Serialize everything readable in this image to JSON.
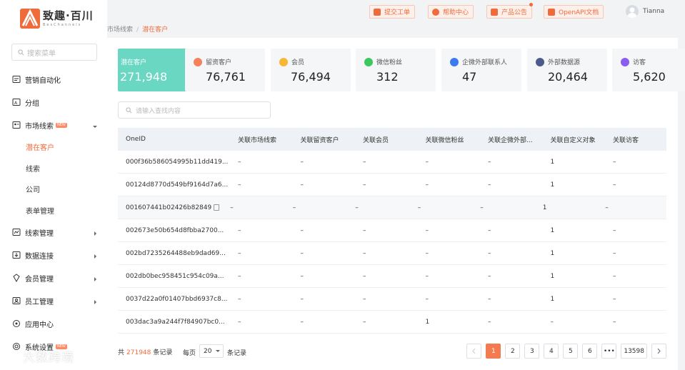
{
  "brand": {
    "name": "致趣·百川",
    "subtitle": "BesChannels"
  },
  "sidebar": {
    "search_placeholder": "搜索菜单",
    "items": [
      {
        "label": "营销自动化",
        "icon": "automation-icon"
      },
      {
        "label": "分组",
        "icon": "group-icon"
      },
      {
        "label": "市场线索",
        "icon": "leads-icon",
        "badge": "NEW",
        "expanded": true
      },
      {
        "label": "线索管理",
        "icon": "lead-manage-icon"
      },
      {
        "label": "数据连接",
        "icon": "data-connect-icon"
      },
      {
        "label": "会员管理",
        "icon": "member-icon"
      },
      {
        "label": "员工管理",
        "icon": "staff-icon"
      },
      {
        "label": "应用中心",
        "icon": "app-center-icon"
      },
      {
        "label": "系统设置",
        "icon": "settings-icon",
        "badge": "NEW"
      }
    ],
    "submenu": [
      "潜在客户",
      "线索",
      "公司",
      "表单管理"
    ]
  },
  "topbar": {
    "buttons": [
      "提交工单",
      "帮助中心",
      "产品公告",
      "OpenAPI文档"
    ],
    "user": "Tianna"
  },
  "breadcrumb": {
    "parent": "市场线索",
    "current": "潜在客户"
  },
  "stats": [
    {
      "label": "潜在客户",
      "value": "271,948",
      "color": "#6ad7c3"
    },
    {
      "label": "留资客户",
      "value": "76,761",
      "color": "#f5825a"
    },
    {
      "label": "会员",
      "value": "76,494",
      "color": "#f7b733"
    },
    {
      "label": "微信粉丝",
      "value": "312",
      "color": "#3cc860"
    },
    {
      "label": "企微外部联系人",
      "value": "47",
      "color": "#3a7bf0"
    },
    {
      "label": "外部数据源",
      "value": "20,464",
      "color": "#4a5b8c"
    },
    {
      "label": "访客",
      "value": "5,620",
      "color": "#8a5cf0"
    }
  ],
  "content_search_placeholder": "请输入查找内容",
  "table": {
    "columns": [
      "OneID",
      "关联市场线索",
      "关联留资客户",
      "关联会员",
      "关联微信粉丝",
      "关联企微外部...",
      "关联自定义对象",
      "关联访客"
    ],
    "rows": [
      [
        "000f36b586054995b11dd419...",
        "–",
        "–",
        "–",
        "–",
        "–",
        "1",
        "–"
      ],
      [
        "00124d8770d549bf9164d7a6...",
        "–",
        "–",
        "–",
        "–",
        "–",
        "1",
        "–"
      ],
      [
        "001607441b02426b82849",
        "–",
        "–",
        "–",
        "–",
        "–",
        "1",
        "–"
      ],
      [
        "002673e50b654d8fbba2700...",
        "–",
        "–",
        "–",
        "–",
        "–",
        "1",
        "–"
      ],
      [
        "002bd7235264488eb9dad69...",
        "–",
        "–",
        "–",
        "–",
        "–",
        "1",
        "–"
      ],
      [
        "002db0bec958451c954c09a...",
        "–",
        "–",
        "–",
        "–",
        "–",
        "1",
        "–"
      ],
      [
        "0037d22a0f01407bbd6937c8...",
        "–",
        "–",
        "–",
        "–",
        "–",
        "1",
        "–"
      ],
      [
        "003dac3a9a244f7f84907bc0...",
        "–",
        "–",
        "–",
        "1",
        "–",
        "–",
        "–"
      ]
    ]
  },
  "footer": {
    "total_prefix": "共",
    "total": "271948",
    "total_suffix": "条记录",
    "per_page_label": "每页",
    "per_page": "20",
    "per_page_suffix": "条记录",
    "pages": [
      "1",
      "2",
      "3",
      "4",
      "5",
      "6",
      "•••",
      "13598"
    ]
  },
  "watermark": "大数跨境"
}
